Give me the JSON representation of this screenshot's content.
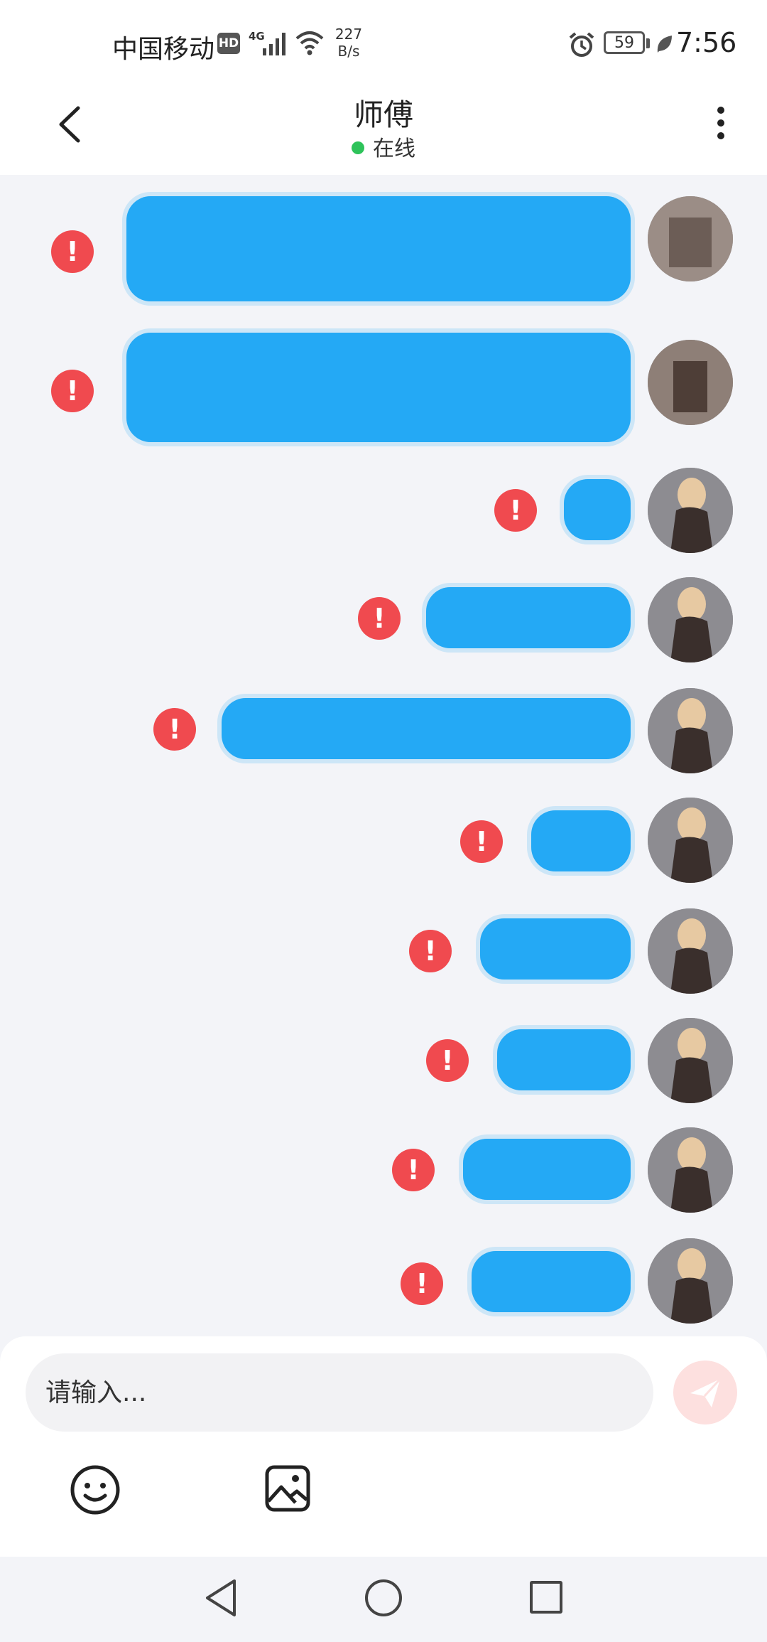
{
  "status_bar": {
    "carrier": "中国移动",
    "hd_badge": "HD",
    "network": "4G",
    "speed": "227\nB/s",
    "battery": "59",
    "time": "7:56"
  },
  "header": {
    "title": "师傅",
    "status": "在线"
  },
  "messages": [
    {
      "text": "",
      "status": "failed"
    },
    {
      "text": "",
      "status": "failed"
    },
    {
      "text": "",
      "status": "failed"
    },
    {
      "text": "",
      "status": "failed"
    },
    {
      "text": "",
      "status": "failed"
    },
    {
      "text": "",
      "status": "failed"
    },
    {
      "text": "",
      "status": "failed"
    },
    {
      "text": "",
      "status": "failed"
    },
    {
      "text": "",
      "status": "failed"
    },
    {
      "text": "",
      "status": "failed"
    }
  ],
  "error_glyph": "!",
  "input": {
    "placeholder": "请输入..."
  },
  "colors": {
    "bubble": "#24a9f5",
    "error": "#f04a4f",
    "online": "#2ec35a",
    "send_disabled": "#fde0df"
  },
  "icons": {
    "back": "chevron-left-icon",
    "more": "more-vertical-icon",
    "send": "paper-plane-icon",
    "emoji": "smiley-icon",
    "image": "image-icon"
  }
}
